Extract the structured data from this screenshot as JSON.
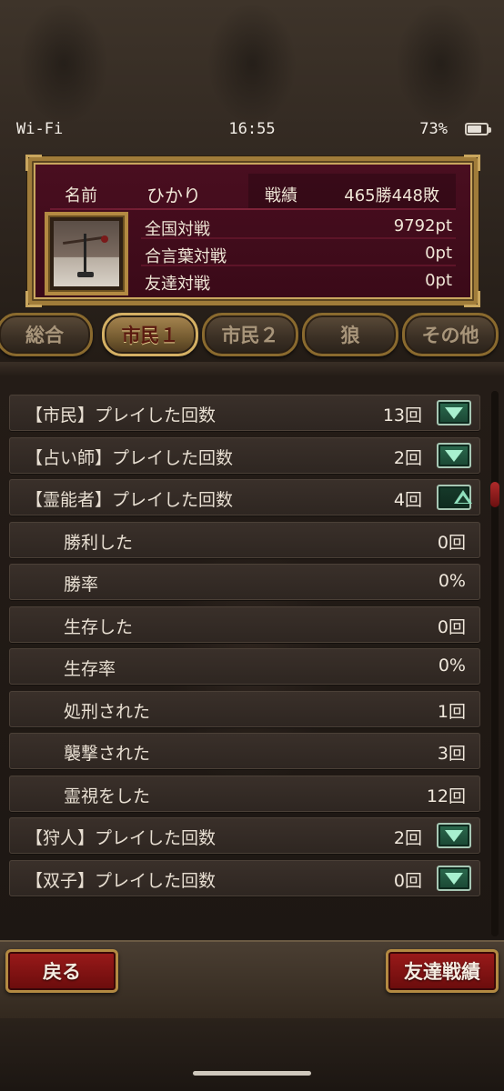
{
  "status_bar": {
    "wifi": "Wi-Fi",
    "time": "16:55",
    "battery": "73%",
    "battery_level": 0.73
  },
  "profile": {
    "name_label": "名前",
    "name": "ひかり",
    "record_label": "戦績",
    "record": "465勝448敗",
    "stats": [
      {
        "label": "全国対戦",
        "value": "9792pt"
      },
      {
        "label": "合言葉対戦",
        "value": "0pt"
      },
      {
        "label": "友達対戦",
        "value": "0pt"
      }
    ]
  },
  "tabs": [
    {
      "label": "総合",
      "active": false
    },
    {
      "label": "市民１",
      "active": true
    },
    {
      "label": "市民２",
      "active": false
    },
    {
      "label": "狼",
      "active": false
    },
    {
      "label": "その他",
      "active": false
    }
  ],
  "rows": [
    {
      "label": "【市民】プレイした回数",
      "value": "13回",
      "toggle": "down"
    },
    {
      "label": "【占い師】プレイした回数",
      "value": "2回",
      "toggle": "down"
    },
    {
      "label": "【霊能者】プレイした回数",
      "value": "4回",
      "toggle": "up"
    },
    {
      "label": "勝利した",
      "value": "0回",
      "sub": true
    },
    {
      "label": "勝率",
      "value": "0%",
      "sub": true
    },
    {
      "label": "生存した",
      "value": "0回",
      "sub": true
    },
    {
      "label": "生存率",
      "value": "0%",
      "sub": true
    },
    {
      "label": "処刑された",
      "value": "1回",
      "sub": true
    },
    {
      "label": "襲撃された",
      "value": "3回",
      "sub": true
    },
    {
      "label": "霊視をした",
      "value": "12回",
      "sub": true
    },
    {
      "label": "【狩人】プレイした回数",
      "value": "2回",
      "toggle": "down"
    },
    {
      "label": "【双子】プレイした回数",
      "value": "0回",
      "toggle": "down"
    }
  ],
  "buttons": {
    "back": "戻る",
    "friend_record": "友達戦績"
  }
}
